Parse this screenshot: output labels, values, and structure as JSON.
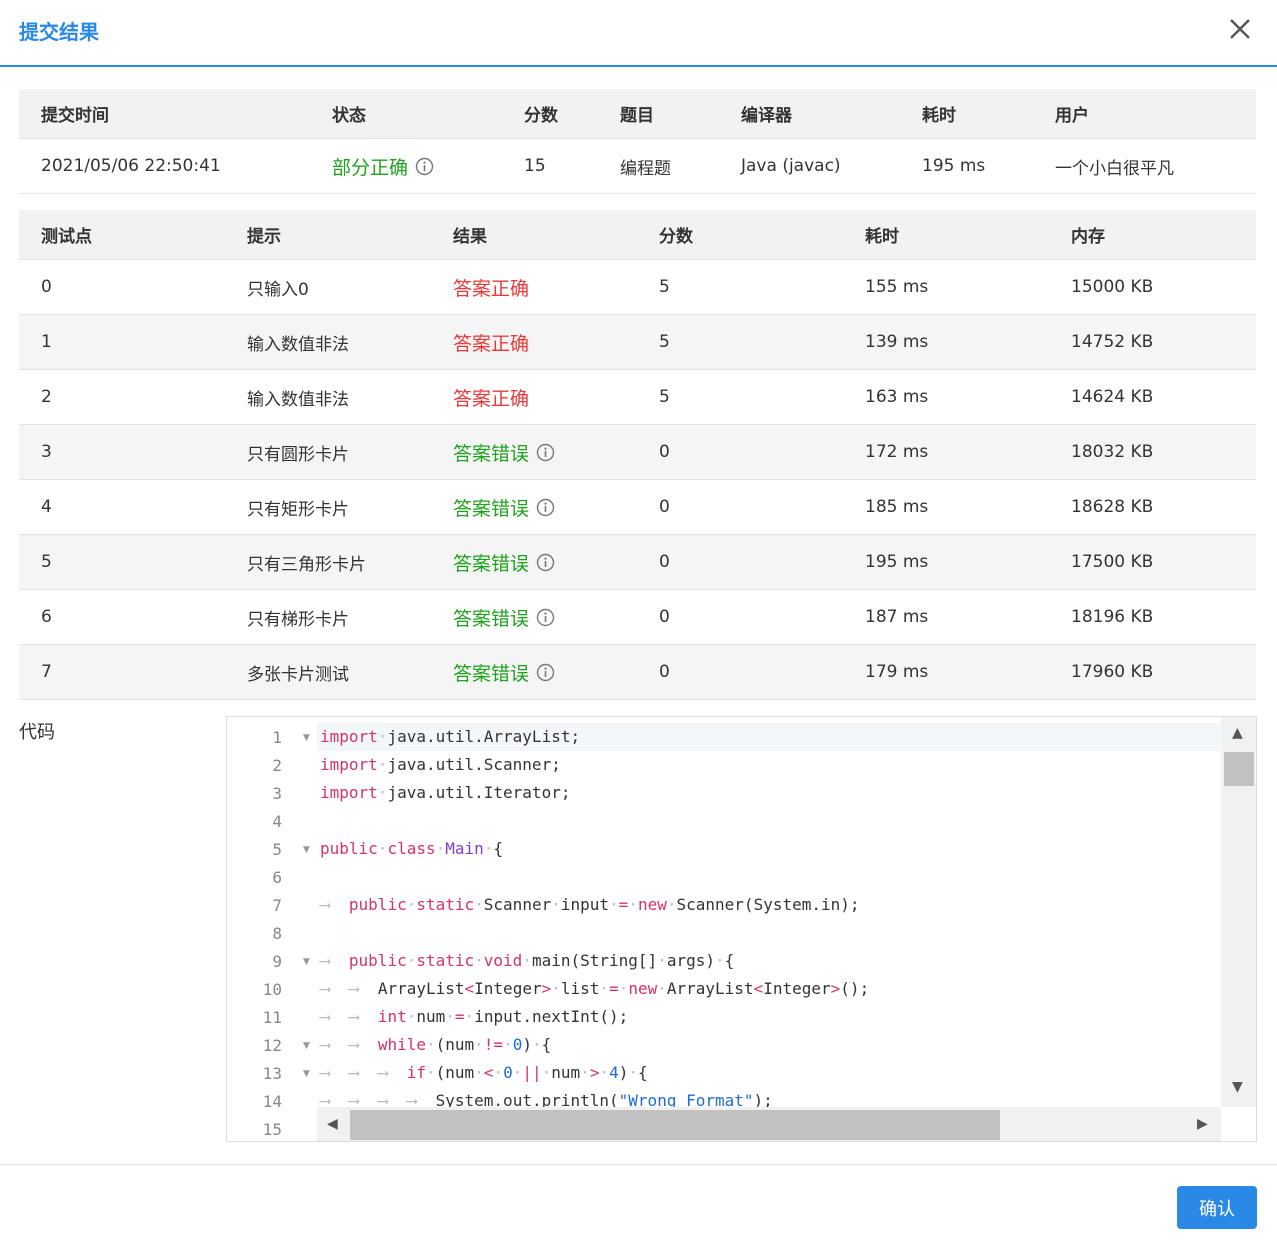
{
  "dialog": {
    "title": "提交结果",
    "confirm_label": "确认"
  },
  "submission": {
    "headers": [
      "提交时间",
      "状态",
      "分数",
      "题目",
      "编译器",
      "耗时",
      "用户"
    ],
    "row": {
      "time": "2021/05/06 22:50:41",
      "status": "部分正确",
      "score": "15",
      "problem": "编程题",
      "compiler": "Java (javac)",
      "duration": "195 ms",
      "user": "一个小白很平凡"
    }
  },
  "tests": {
    "headers": [
      "测试点",
      "提示",
      "结果",
      "分数",
      "耗时",
      "内存"
    ],
    "rows": [
      {
        "id": "0",
        "hint": "只输入0",
        "result": "答案正确",
        "ok": true,
        "score": "5",
        "time": "155 ms",
        "memory": "15000 KB"
      },
      {
        "id": "1",
        "hint": "输入数值非法",
        "result": "答案正确",
        "ok": true,
        "score": "5",
        "time": "139 ms",
        "memory": "14752 KB"
      },
      {
        "id": "2",
        "hint": "输入数值非法",
        "result": "答案正确",
        "ok": true,
        "score": "5",
        "time": "163 ms",
        "memory": "14624 KB"
      },
      {
        "id": "3",
        "hint": "只有圆形卡片",
        "result": "答案错误",
        "ok": false,
        "score": "0",
        "time": "172 ms",
        "memory": "18032 KB"
      },
      {
        "id": "4",
        "hint": "只有矩形卡片",
        "result": "答案错误",
        "ok": false,
        "score": "0",
        "time": "185 ms",
        "memory": "18628 KB"
      },
      {
        "id": "5",
        "hint": "只有三角形卡片",
        "result": "答案错误",
        "ok": false,
        "score": "0",
        "time": "195 ms",
        "memory": "17500 KB"
      },
      {
        "id": "6",
        "hint": "只有梯形卡片",
        "result": "答案错误",
        "ok": false,
        "score": "0",
        "time": "187 ms",
        "memory": "18196 KB"
      },
      {
        "id": "7",
        "hint": "多张卡片测试",
        "result": "答案错误",
        "ok": false,
        "score": "0",
        "time": "179 ms",
        "memory": "17960 KB"
      }
    ]
  },
  "code": {
    "label": "代码",
    "line_numbers": [
      "1",
      "2",
      "3",
      "4",
      "5",
      "6",
      "7",
      "8",
      "9",
      "10",
      "11",
      "12",
      "13",
      "14",
      "15"
    ],
    "lines": [
      "import java.util.ArrayList;",
      "import java.util.Scanner;",
      "import java.util.Iterator;",
      "",
      "public class Main {",
      "",
      "\tpublic static Scanner input = new Scanner(System.in);",
      "",
      "\tpublic static void main(String[] args) {",
      "\t\tArrayList<Integer> list = new ArrayList<Integer>();",
      "\t\tint num = input.nextInt();",
      "\t\twhile (num != 0) {",
      "\t\t\tif (num < 0 || num > 4) {",
      "\t\t\t\tSystem.out.println(\"Wrong Format\");",
      ""
    ]
  },
  "icons": {
    "close": "close-icon",
    "info": "info-circle-icon",
    "fold": "fold-arrow-icon",
    "scroll_up": "scroll-up-arrow-icon",
    "scroll_down": "scroll-down-arrow-icon",
    "scroll_left": "scroll-left-arrow-icon",
    "scroll_right": "scroll-right-arrow-icon"
  },
  "colors": {
    "accent": "#2a88e6",
    "success": "#1fa31f",
    "error": "#e83a3a"
  }
}
